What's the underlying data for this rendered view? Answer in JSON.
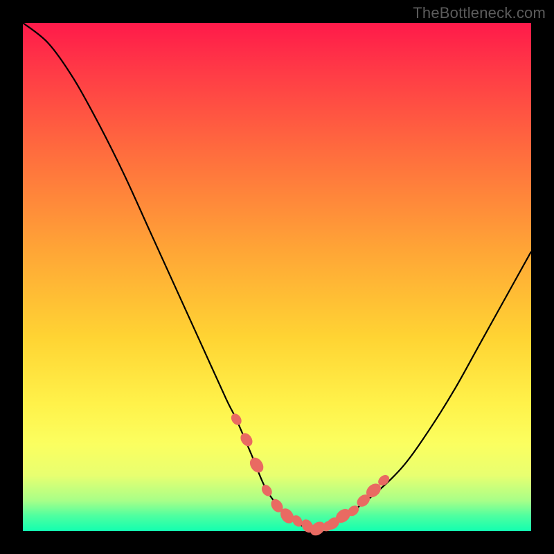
{
  "watermark": "TheBottleneck.com",
  "chart_data": {
    "type": "line",
    "title": "",
    "xlabel": "",
    "ylabel": "",
    "xlim": [
      0,
      100
    ],
    "ylim": [
      0,
      100
    ],
    "series": [
      {
        "name": "curve",
        "x": [
          0,
          5,
          10,
          15,
          20,
          25,
          30,
          35,
          40,
          42,
          45,
          48,
          52,
          55,
          58,
          60,
          62,
          65,
          70,
          75,
          80,
          85,
          90,
          95,
          100
        ],
        "y": [
          100,
          96,
          89,
          80,
          70,
          59,
          48,
          37,
          26,
          22,
          15,
          8,
          3,
          1,
          0.5,
          1,
          2,
          4,
          8,
          13,
          20,
          28,
          37,
          46,
          55
        ]
      }
    ],
    "markers": {
      "name": "highlighted-points",
      "x": [
        42,
        44,
        46,
        48,
        50,
        52,
        54,
        56,
        58,
        60,
        61,
        63,
        65,
        67,
        69,
        71
      ],
      "y": [
        22,
        18,
        13,
        8,
        5,
        3,
        2,
        1,
        0.5,
        1,
        1.5,
        3,
        4,
        6,
        8,
        10
      ]
    },
    "gradient_stops": [
      {
        "pos": 0,
        "color": "#ff1a4a"
      },
      {
        "pos": 25,
        "color": "#ff6b3e"
      },
      {
        "pos": 62,
        "color": "#ffd433"
      },
      {
        "pos": 89,
        "color": "#e8ff70"
      },
      {
        "pos": 100,
        "color": "#12ffb0"
      }
    ]
  }
}
